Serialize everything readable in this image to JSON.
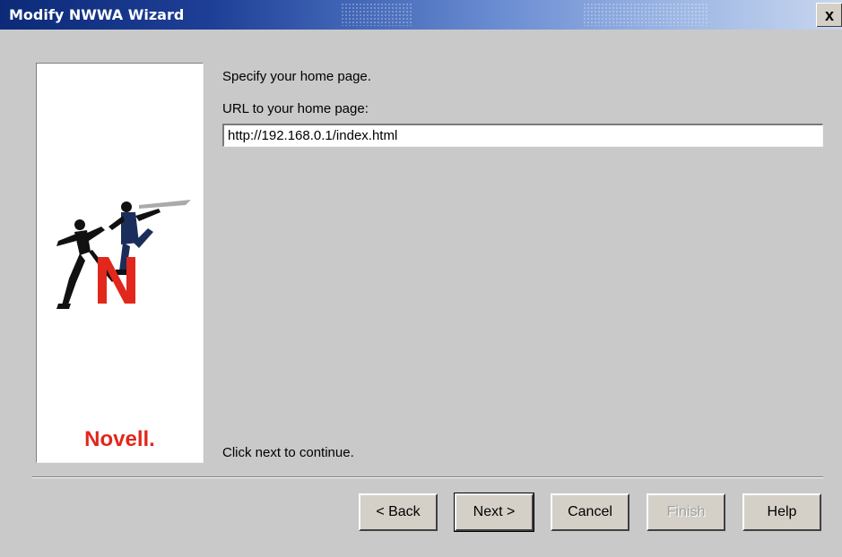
{
  "window": {
    "title": "Modify NWWA Wizard",
    "close_label": "x"
  },
  "sidebar": {
    "brand": "Novell."
  },
  "main": {
    "instruction": "Specify your home page.",
    "url_label": "URL to your home page:",
    "url_value": "http://192.168.0.1/index.html",
    "footer_text": "Click next to continue."
  },
  "buttons": {
    "back": "< Back",
    "next": "Next >",
    "cancel": "Cancel",
    "finish": "Finish",
    "help": "Help"
  },
  "colors": {
    "brand_red": "#e2271c",
    "titlebar_dark": "#0c2a78",
    "dialog_bg": "#c9c9c9"
  }
}
